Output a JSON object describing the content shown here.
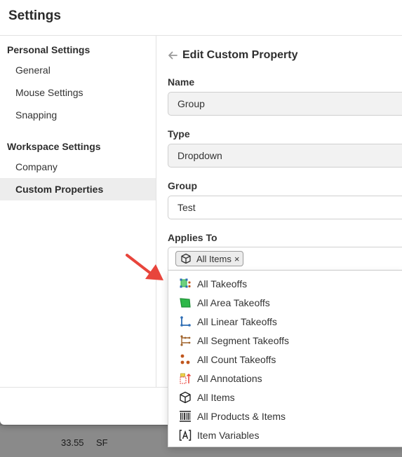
{
  "modal": {
    "title": "Settings"
  },
  "sidebar": {
    "personal_heading": "Personal Settings",
    "personal_items": [
      {
        "label": "General"
      },
      {
        "label": "Mouse Settings"
      },
      {
        "label": "Snapping"
      }
    ],
    "workspace_heading": "Workspace Settings",
    "workspace_items": [
      {
        "label": "Company"
      },
      {
        "label": "Custom Properties",
        "active": true
      }
    ]
  },
  "editor": {
    "back_icon": "arrow-left-icon",
    "title": "Edit Custom Property",
    "name_label": "Name",
    "name_value": "Group",
    "type_label": "Type",
    "type_value": "Dropdown",
    "group_label": "Group",
    "group_value": "Test",
    "applies_label": "Applies To",
    "selected_chip": {
      "label": "All Items",
      "icon": "cube-icon",
      "remove": "×"
    }
  },
  "dropdown_options": [
    {
      "label": "All Takeoffs",
      "icon": "takeoffs-icon"
    },
    {
      "label": "All Area Takeoffs",
      "icon": "area-takeoff-icon"
    },
    {
      "label": "All Linear Takeoffs",
      "icon": "linear-takeoff-icon"
    },
    {
      "label": "All Segment Takeoffs",
      "icon": "segment-takeoff-icon"
    },
    {
      "label": "All Count Takeoffs",
      "icon": "count-takeoff-icon"
    },
    {
      "label": "All Annotations",
      "icon": "annotation-icon"
    },
    {
      "label": "All Items",
      "icon": "cube-icon"
    },
    {
      "label": "All Products & Items",
      "icon": "barcode-icon"
    },
    {
      "label": "Item Variables",
      "icon": "variable-bracket-icon"
    }
  ],
  "background_row": {
    "quantity": "33.55",
    "unit": "SF"
  },
  "colors": {
    "annotation_arrow": "#e8453c",
    "takeoff_green": "#2fb84a",
    "takeoff_blue": "#2e6db4",
    "segment_brown": "#a0642c",
    "count_orange": "#c0561d"
  }
}
